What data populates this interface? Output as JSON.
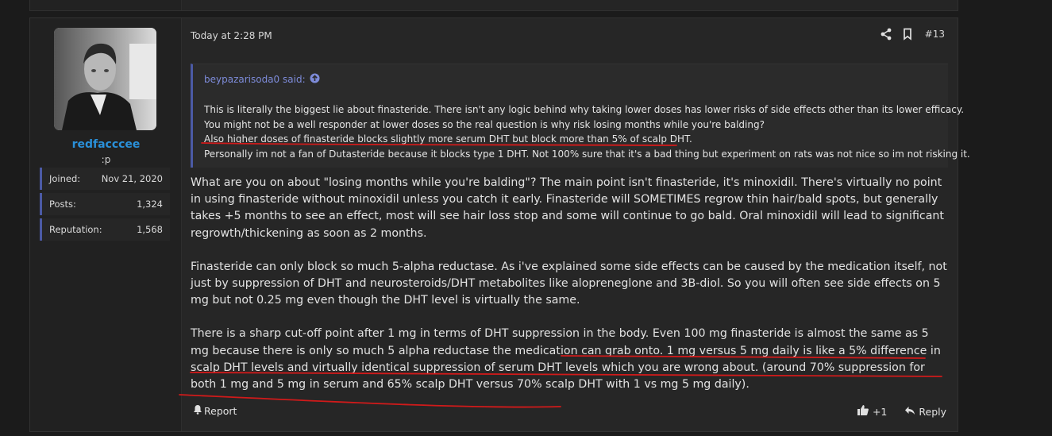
{
  "user": {
    "name": "redfacccee",
    "title": ":p",
    "stats": [
      {
        "label": "Joined:",
        "value": "Nov 21, 2020"
      },
      {
        "label": "Posts:",
        "value": "1,324"
      },
      {
        "label": "Reputation:",
        "value": "1,568"
      }
    ]
  },
  "post": {
    "date": "Today at 2:28 PM",
    "number": "#13",
    "quote": {
      "author": "beypazarisoda0 said:",
      "lines": [
        "This is literally the biggest lie about finasteride. There isn't any logic behind why taking lower doses has lower risks of side effects other than its lower efficacy.",
        "You might not be a well responder at lower doses so the real question is why risk losing months while you're balding?",
        "Also higher doses of finasteride blocks slightly more serum DHT but block more than 5% of scalp DHT.",
        "Personally im not a fan of Dutasteride because it blocks type 1 DHT. Not 100% sure that it's a bad thing but experiment on rats was not nice so im not risking it."
      ]
    },
    "paragraphs": [
      "What are you on about \"losing months while you're balding\"? The main point isn't finasteride, it's minoxidil. There's virtually no point in using finasteride without minoxidil unless you catch it early. Finasteride will SOMETIMES regrow thin hair/bald spots, but generally takes +5 months to see an effect, most will see hair loss stop and some will continue to go bald. Oral minoxidil will lead to significant regrowth/thickening as soon as 2 months.",
      "Finasteride can only block so much 5-alpha reductase. As i've explained some side effects can be caused by the medication itself, not just by suppression of DHT and neurosteroids/DHT metabolites like alopreneglone and 3B-diol. So you will often see side effects on 5 mg but not 0.25 mg even though the DHT level is virtually the same.",
      "There is a sharp cut-off point after 1 mg in terms of DHT suppression in the body. Even 100 mg finasteride is almost the same as 5 mg because there is only so much 5 alpha reductase the medication can grab onto. 1 mg versus 5 mg daily is like a 5% difference in scalp DHT levels and virtually identical suppression of serum DHT levels which you are wrong about. (around 70% suppression for both 1 mg and 5 mg in serum and 65% scalp DHT versus 70% scalp DHT with 1 vs mg 5 mg daily)."
    ],
    "report_label": "Report",
    "reaction_count": "+1",
    "reply_label": "Reply"
  },
  "icons": {
    "share": "share-icon",
    "bookmark": "bookmark-icon",
    "quote_jump": "arrow-up-circle-icon",
    "report": "bell-icon",
    "like": "thumbs-up-icon",
    "reply": "reply-icon"
  },
  "colors": {
    "username": "#2a90d9",
    "quote_border": "#4b5aa5",
    "annotation": "#d11a1a"
  }
}
